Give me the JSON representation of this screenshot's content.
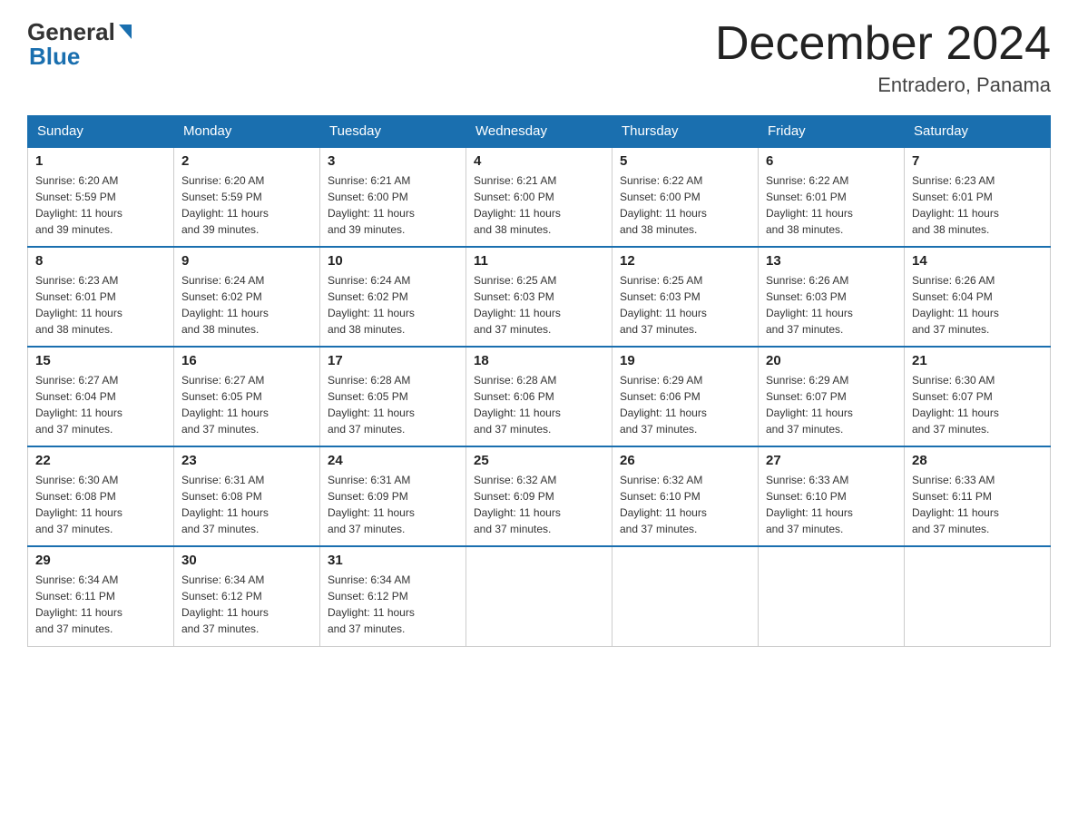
{
  "header": {
    "logo_text_general": "General",
    "logo_text_blue": "Blue",
    "month_title": "December 2024",
    "location": "Entradero, Panama"
  },
  "weekdays": [
    "Sunday",
    "Monday",
    "Tuesday",
    "Wednesday",
    "Thursday",
    "Friday",
    "Saturday"
  ],
  "weeks": [
    [
      {
        "day": "1",
        "sunrise": "6:20 AM",
        "sunset": "5:59 PM",
        "daylight": "11 hours and 39 minutes."
      },
      {
        "day": "2",
        "sunrise": "6:20 AM",
        "sunset": "5:59 PM",
        "daylight": "11 hours and 39 minutes."
      },
      {
        "day": "3",
        "sunrise": "6:21 AM",
        "sunset": "6:00 PM",
        "daylight": "11 hours and 39 minutes."
      },
      {
        "day": "4",
        "sunrise": "6:21 AM",
        "sunset": "6:00 PM",
        "daylight": "11 hours and 38 minutes."
      },
      {
        "day": "5",
        "sunrise": "6:22 AM",
        "sunset": "6:00 PM",
        "daylight": "11 hours and 38 minutes."
      },
      {
        "day": "6",
        "sunrise": "6:22 AM",
        "sunset": "6:01 PM",
        "daylight": "11 hours and 38 minutes."
      },
      {
        "day": "7",
        "sunrise": "6:23 AM",
        "sunset": "6:01 PM",
        "daylight": "11 hours and 38 minutes."
      }
    ],
    [
      {
        "day": "8",
        "sunrise": "6:23 AM",
        "sunset": "6:01 PM",
        "daylight": "11 hours and 38 minutes."
      },
      {
        "day": "9",
        "sunrise": "6:24 AM",
        "sunset": "6:02 PM",
        "daylight": "11 hours and 38 minutes."
      },
      {
        "day": "10",
        "sunrise": "6:24 AM",
        "sunset": "6:02 PM",
        "daylight": "11 hours and 38 minutes."
      },
      {
        "day": "11",
        "sunrise": "6:25 AM",
        "sunset": "6:03 PM",
        "daylight": "11 hours and 37 minutes."
      },
      {
        "day": "12",
        "sunrise": "6:25 AM",
        "sunset": "6:03 PM",
        "daylight": "11 hours and 37 minutes."
      },
      {
        "day": "13",
        "sunrise": "6:26 AM",
        "sunset": "6:03 PM",
        "daylight": "11 hours and 37 minutes."
      },
      {
        "day": "14",
        "sunrise": "6:26 AM",
        "sunset": "6:04 PM",
        "daylight": "11 hours and 37 minutes."
      }
    ],
    [
      {
        "day": "15",
        "sunrise": "6:27 AM",
        "sunset": "6:04 PM",
        "daylight": "11 hours and 37 minutes."
      },
      {
        "day": "16",
        "sunrise": "6:27 AM",
        "sunset": "6:05 PM",
        "daylight": "11 hours and 37 minutes."
      },
      {
        "day": "17",
        "sunrise": "6:28 AM",
        "sunset": "6:05 PM",
        "daylight": "11 hours and 37 minutes."
      },
      {
        "day": "18",
        "sunrise": "6:28 AM",
        "sunset": "6:06 PM",
        "daylight": "11 hours and 37 minutes."
      },
      {
        "day": "19",
        "sunrise": "6:29 AM",
        "sunset": "6:06 PM",
        "daylight": "11 hours and 37 minutes."
      },
      {
        "day": "20",
        "sunrise": "6:29 AM",
        "sunset": "6:07 PM",
        "daylight": "11 hours and 37 minutes."
      },
      {
        "day": "21",
        "sunrise": "6:30 AM",
        "sunset": "6:07 PM",
        "daylight": "11 hours and 37 minutes."
      }
    ],
    [
      {
        "day": "22",
        "sunrise": "6:30 AM",
        "sunset": "6:08 PM",
        "daylight": "11 hours and 37 minutes."
      },
      {
        "day": "23",
        "sunrise": "6:31 AM",
        "sunset": "6:08 PM",
        "daylight": "11 hours and 37 minutes."
      },
      {
        "day": "24",
        "sunrise": "6:31 AM",
        "sunset": "6:09 PM",
        "daylight": "11 hours and 37 minutes."
      },
      {
        "day": "25",
        "sunrise": "6:32 AM",
        "sunset": "6:09 PM",
        "daylight": "11 hours and 37 minutes."
      },
      {
        "day": "26",
        "sunrise": "6:32 AM",
        "sunset": "6:10 PM",
        "daylight": "11 hours and 37 minutes."
      },
      {
        "day": "27",
        "sunrise": "6:33 AM",
        "sunset": "6:10 PM",
        "daylight": "11 hours and 37 minutes."
      },
      {
        "day": "28",
        "sunrise": "6:33 AM",
        "sunset": "6:11 PM",
        "daylight": "11 hours and 37 minutes."
      }
    ],
    [
      {
        "day": "29",
        "sunrise": "6:34 AM",
        "sunset": "6:11 PM",
        "daylight": "11 hours and 37 minutes."
      },
      {
        "day": "30",
        "sunrise": "6:34 AM",
        "sunset": "6:12 PM",
        "daylight": "11 hours and 37 minutes."
      },
      {
        "day": "31",
        "sunrise": "6:34 AM",
        "sunset": "6:12 PM",
        "daylight": "11 hours and 37 minutes."
      },
      null,
      null,
      null,
      null
    ]
  ],
  "labels": {
    "sunrise": "Sunrise:",
    "sunset": "Sunset:",
    "daylight": "Daylight:"
  }
}
